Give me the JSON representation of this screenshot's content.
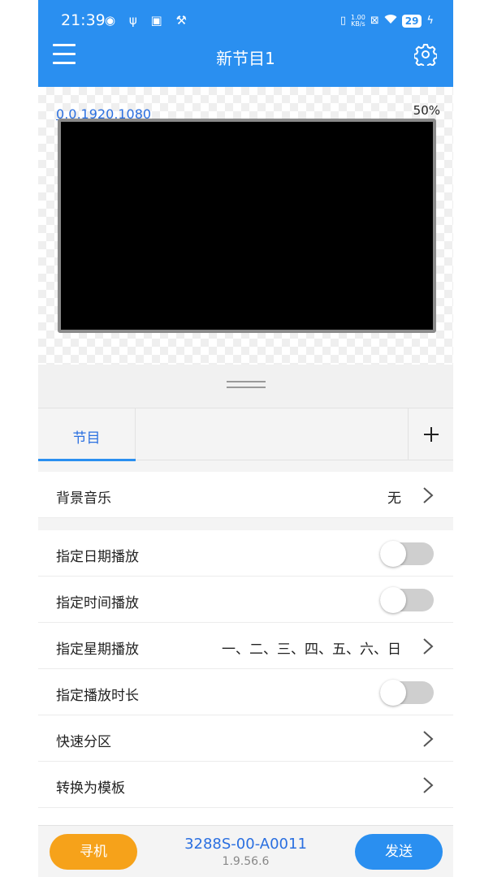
{
  "status_bar": {
    "time": "21:39",
    "left_icons": "◉ ψ ▣ ⚒",
    "netspeed_value": "1.00",
    "netspeed_unit": "KB/s",
    "battery": "29"
  },
  "app_bar": {
    "title": "新节目1"
  },
  "preview": {
    "coords": "0,0,1920,1080",
    "zoom": "50%"
  },
  "tabs": [
    {
      "label": "节目"
    }
  ],
  "settings": {
    "bg_music": {
      "label": "背景音乐",
      "value": "无"
    },
    "date_play": {
      "label": "指定日期播放",
      "enabled": false
    },
    "time_play": {
      "label": "指定时间播放",
      "enabled": false
    },
    "week_play": {
      "label": "指定星期播放",
      "value": "一、二、三、四、五、六、日"
    },
    "duration_play": {
      "label": "指定播放时长",
      "enabled": false
    },
    "quick_partition": {
      "label": "快速分区"
    },
    "convert_template": {
      "label": "转换为模板"
    }
  },
  "bottom_bar": {
    "find_label": "寻机",
    "device_id": "3288S-00-A0011",
    "version": "1.9.56.6",
    "send_label": "发送"
  },
  "colors": {
    "primary": "#2a8ff0",
    "accent_orange": "#f6a21a",
    "link_blue": "#2a6fe0"
  }
}
